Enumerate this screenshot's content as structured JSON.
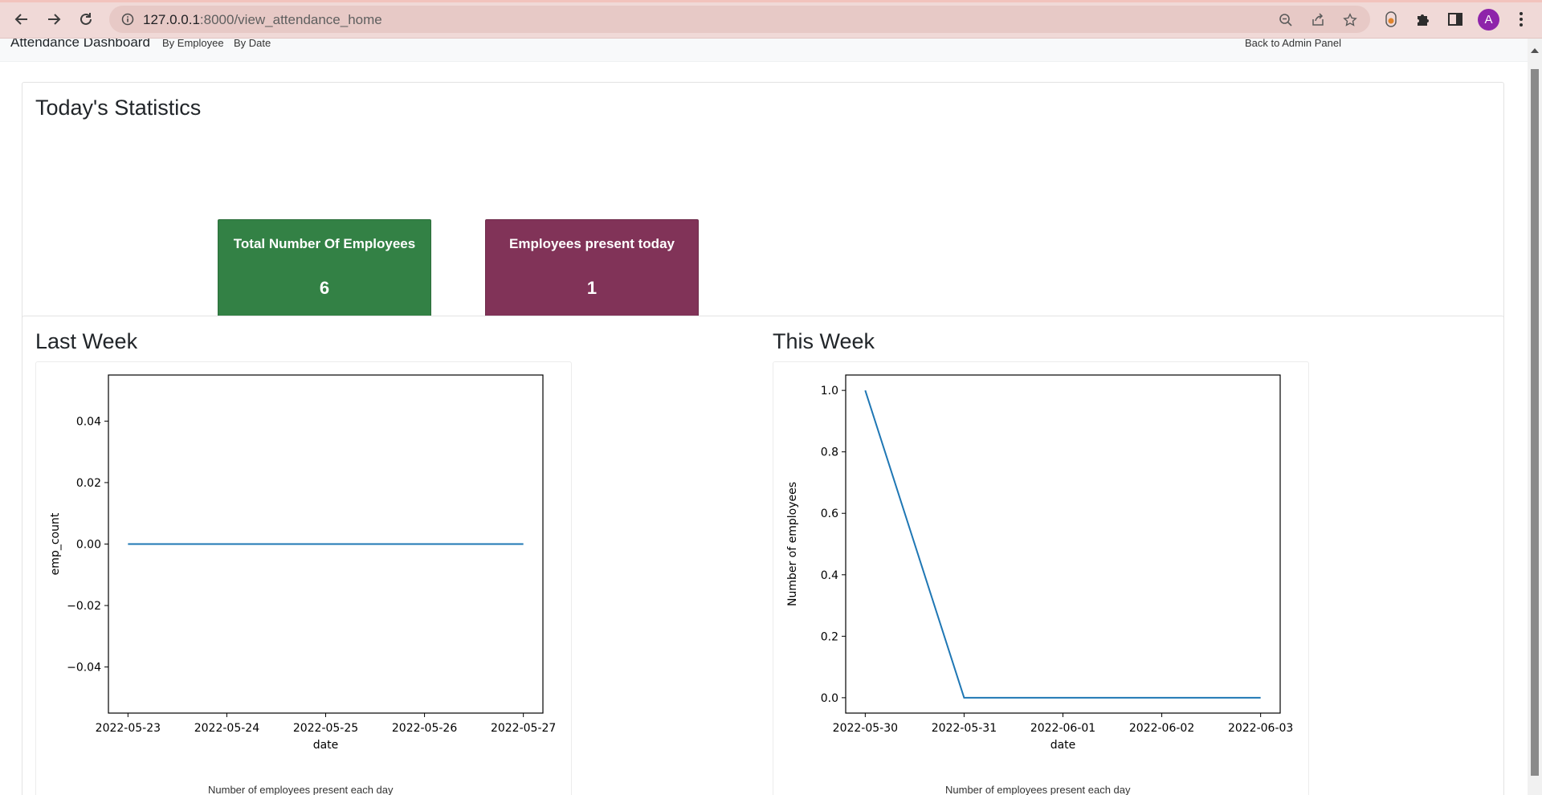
{
  "browser": {
    "url_host": "127.0.0.1",
    "url_rest": ":8000/view_attendance_home",
    "avatar_letter": "A",
    "icons": [
      "back-arrow-icon",
      "forward-arrow-icon",
      "reload-icon",
      "info-icon",
      "zoom-icon",
      "share-icon",
      "star-icon",
      "extension-icon",
      "puzzle-icon",
      "sidepanel-icon",
      "menu-dots-icon"
    ]
  },
  "nav": {
    "brand": "Attendance Dashboard",
    "by_employee": "By Employee",
    "by_date": "By Date",
    "back": "Back to Admin Panel"
  },
  "today": {
    "title": "Today's Statistics",
    "total_label": "Total Number Of Employees",
    "total_value": "6",
    "present_label": "Employees present today",
    "present_value": "1",
    "colors": {
      "total": "#338145",
      "present": "#813358"
    }
  },
  "weeks": {
    "last_title": "Last Week",
    "this_title": "This Week",
    "last_caption": "Number of employees present each day",
    "this_caption": "Number of employees present each day"
  },
  "chart_data": [
    {
      "type": "line",
      "x": [
        "2022-05-23",
        "2022-05-24",
        "2022-05-25",
        "2022-05-26",
        "2022-05-27"
      ],
      "series": [
        {
          "values": [
            0,
            0,
            0,
            0,
            0
          ]
        }
      ],
      "xlabel": "date",
      "ylabel": "emp_count",
      "ylim": [
        -0.055,
        0.055
      ],
      "yticks": [
        "0.04",
        "0.02",
        "0.00",
        "−0.02",
        "−0.04"
      ],
      "ytick_values": [
        0.04,
        0.02,
        0,
        -0.02,
        -0.04
      ],
      "line_color": "#1f77b4"
    },
    {
      "type": "line",
      "x": [
        "2022-05-30",
        "2022-05-31",
        "2022-06-01",
        "2022-06-02",
        "2022-06-03"
      ],
      "series": [
        {
          "values": [
            1,
            0,
            0,
            0,
            0
          ]
        }
      ],
      "xlabel": "date",
      "ylabel": "Number of employees",
      "ylim": [
        -0.05,
        1.05
      ],
      "yticks": [
        "1.0",
        "0.8",
        "0.6",
        "0.4",
        "0.2",
        "0.0"
      ],
      "ytick_values": [
        1.0,
        0.8,
        0.6,
        0.4,
        0.2,
        0.0
      ],
      "line_color": "#1f77b4"
    }
  ]
}
